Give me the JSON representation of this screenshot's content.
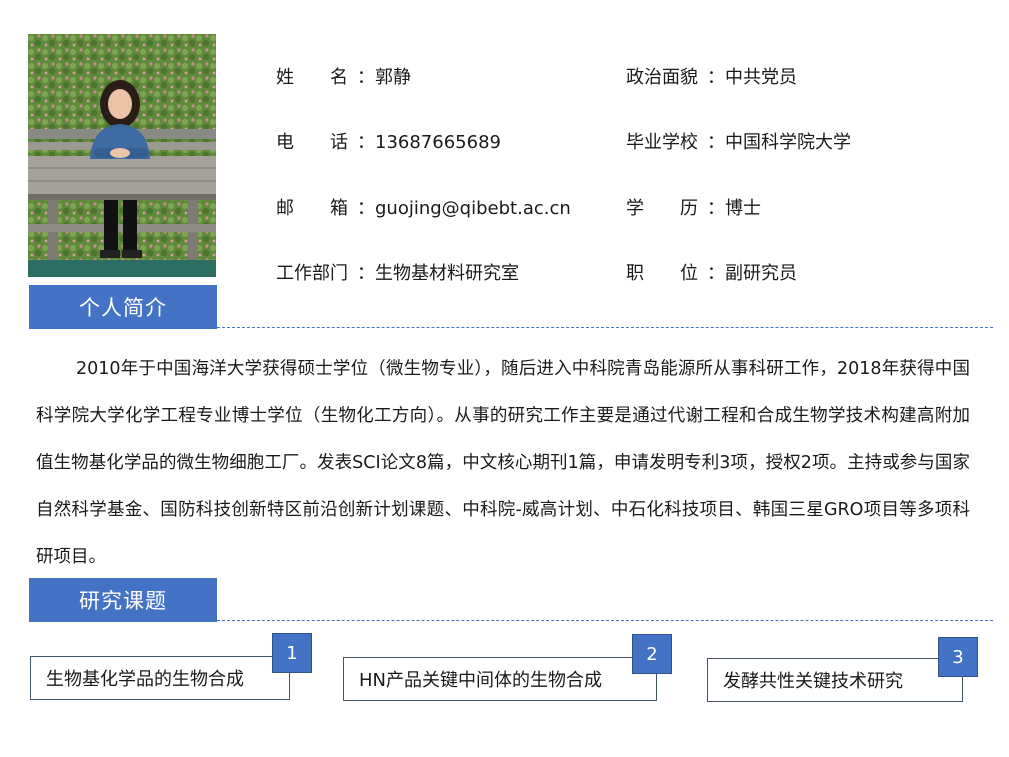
{
  "profile": {
    "photo_icon": "person-photo",
    "fields": [
      {
        "label": "姓　　名",
        "sep": "：",
        "value": "郭静"
      },
      {
        "label": "政治面貌",
        "sep": "：",
        "value": "中共党员"
      },
      {
        "label": "电　　话",
        "sep": "：",
        "value": "13687665689"
      },
      {
        "label": "毕业学校",
        "sep": "：",
        "value": "中国科学院大学"
      },
      {
        "label": "邮　　箱",
        "sep": "：",
        "value": "guojing@qibebt.ac.cn"
      },
      {
        "label": "学　　历",
        "sep": "：",
        "value": "博士"
      },
      {
        "label": "工作部门",
        "sep": "：",
        "value": "生物基材料研究室"
      },
      {
        "label": "职　　位",
        "sep": "：",
        "value": "副研究员"
      }
    ]
  },
  "sections": {
    "intro_title": "个人简介",
    "topics_title": "研究课题"
  },
  "bio": "2010年于中国海洋大学获得硕士学位（微生物专业），随后进入中科院青岛能源所从事科研工作，2018年获得中国科学院大学化学工程专业博士学位（生物化工方向）。从事的研究工作主要是通过代谢工程和合成生物学技术构建高附加值生物基化学品的微生物细胞工厂。发表SCI论文8篇，中文核心期刊1篇，申请发明专利3项，授权2项。主持或参与国家自然科学基金、国防科技创新特区前沿创新计划课题、中科院-威高计划、中石化科技项目、韩国三星GRO项目等多项科研项目。",
  "topics": [
    {
      "num": "1",
      "label": "生物基化学品的生物合成"
    },
    {
      "num": "2",
      "label": "HN产品关键中间体的生物合成"
    },
    {
      "num": "3",
      "label": "发酵共性关键技术研究"
    }
  ],
  "colors": {
    "accent": "#4472c4",
    "box_border": "#44546a"
  }
}
